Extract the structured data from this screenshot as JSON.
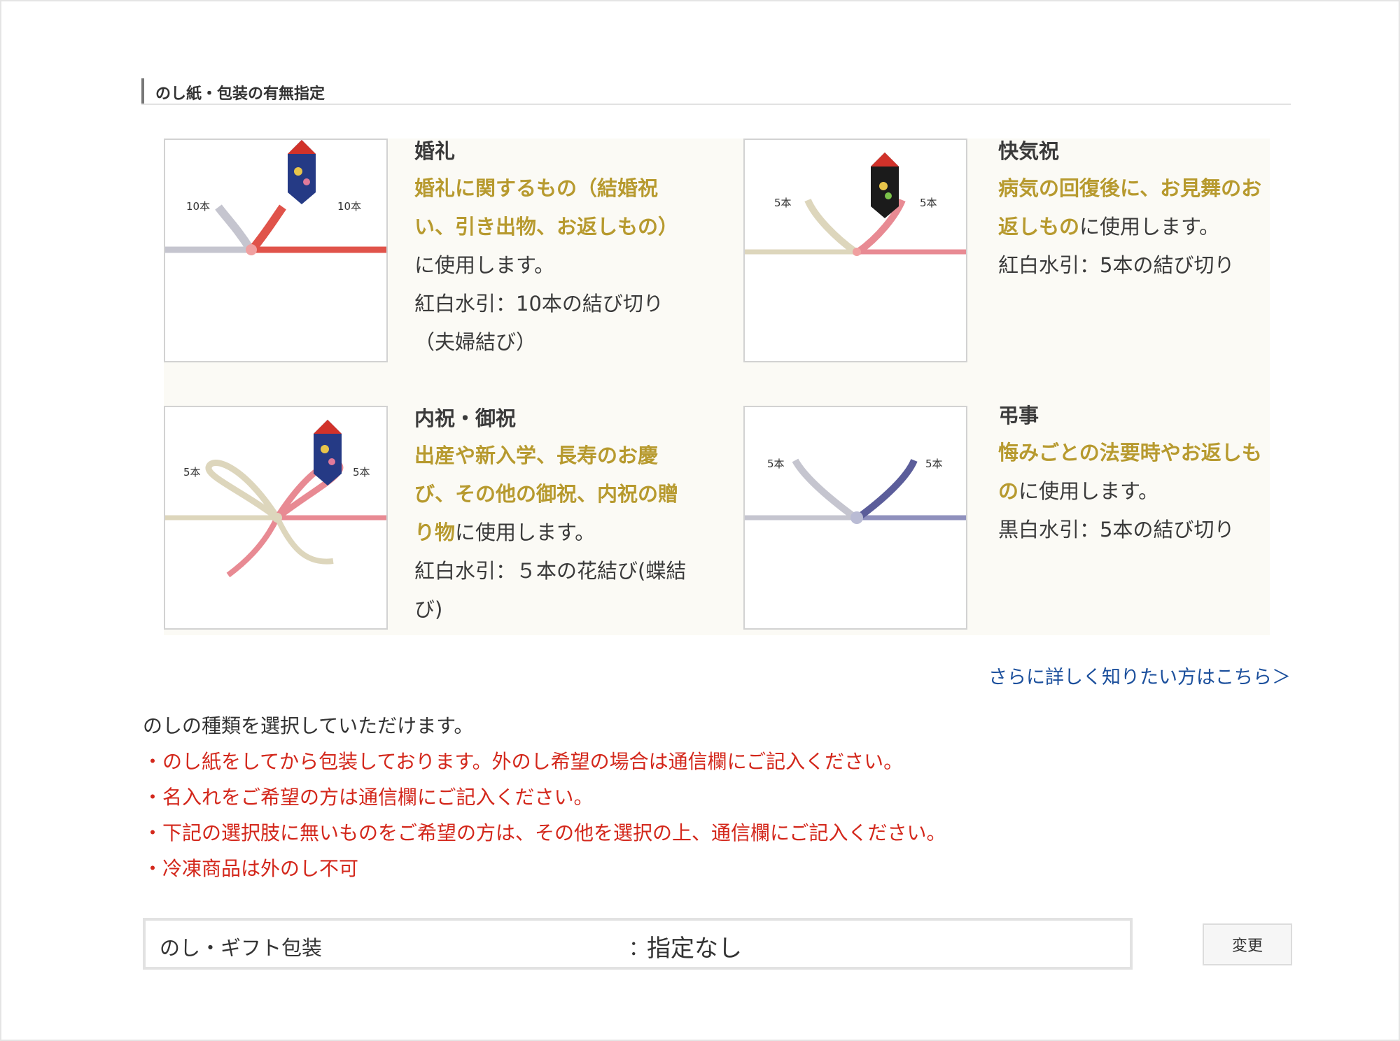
{
  "section": {
    "title": "のし紙・包装の有無指定"
  },
  "cards": [
    {
      "title": "婚礼",
      "desc_gold": "婚礼に関するもの（結婚祝い、引き出物、お返しもの）",
      "desc_rest": "に使用します。",
      "spec": "紅白水引：10本の結び切り（夫婦結び）",
      "left_count": "10本",
      "right_count": "10本"
    },
    {
      "title": "快気祝",
      "desc_gold": "病気の回復後に、お見舞のお返しもの",
      "desc_rest": "に使用します。",
      "spec": "紅白水引：5本の結び切り",
      "left_count": "5本",
      "right_count": "5本"
    },
    {
      "title": "内祝・御祝",
      "desc_gold": "出産や新入学、長寿のお慶び、その他の御祝、内祝の贈り物",
      "desc_rest": "に使用します。",
      "spec": "紅白水引：５本の花結び(蝶結び)",
      "left_count": "5本",
      "right_count": "5本"
    },
    {
      "title": "弔事",
      "desc_gold": "悔みごとの法要時やお返しもの",
      "desc_rest": "に使用します。",
      "spec": "黒白水引：5本の結び切り",
      "left_count": "5本",
      "right_count": "5本"
    }
  ],
  "more_link": "さらに詳しく知りたい方はこちら＞",
  "notes": {
    "lead": "のしの種類を選択していただけます。",
    "items": [
      "・のし紙をしてから包装しております。外のし希望の場合は通信欄にご記入ください。",
      "・名入れをご希望の方は通信欄にご記入ください。",
      "・下記の選択肢に無いものをご希望の方は、その他を選択の上、通信欄にご記入ください。",
      "・冷凍商品は外のし不可"
    ]
  },
  "selection": {
    "label": "のし・ギフト包装",
    "colon": "：",
    "value": "指定なし"
  },
  "change_button": "変更",
  "colors": {
    "gold": "#b79a2f",
    "red": "#d3271b",
    "link": "#1b4f9c",
    "mizuhiki_red": "#e0534a",
    "mizuhiki_pink": "#e88a93",
    "mizuhiki_silver": "#c5c5cf",
    "mizuhiki_cream": "#ddd6bc",
    "mizuhiki_navy": "#5b5d9a"
  }
}
